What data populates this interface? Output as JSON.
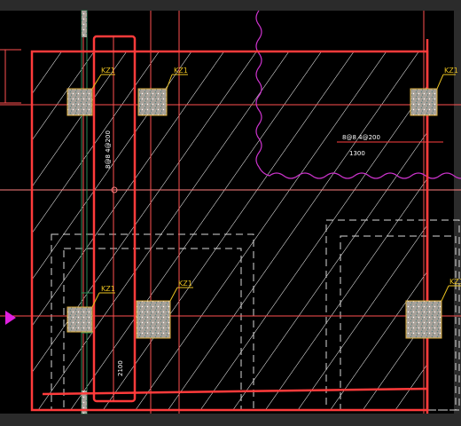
{
  "drawing": {
    "column_label": "KZ1",
    "beam_annotation_vertical": "8@8 4@200",
    "beam_annotation_horizontal": "8@8 4@200",
    "span_dimension_short": "1300",
    "span_dimension_long": "2100"
  },
  "colors": {
    "background": "#000000",
    "slab_outline": "#ff3b3b",
    "axis_line": "#ff5050",
    "hatch": "#ffffff",
    "dashed_footing": "#d8d8d8",
    "column_fill": "#a9a29a",
    "column_border": "#e0b040",
    "column_label": "#e8c020",
    "cloud_revision": "#cc33cc",
    "annotation_text": "#ffffff",
    "leader_line": "#ff4040",
    "green_strip": "#2e8b57",
    "side_marker": "#e020e0",
    "ui_bar": "#2b2b2b"
  }
}
